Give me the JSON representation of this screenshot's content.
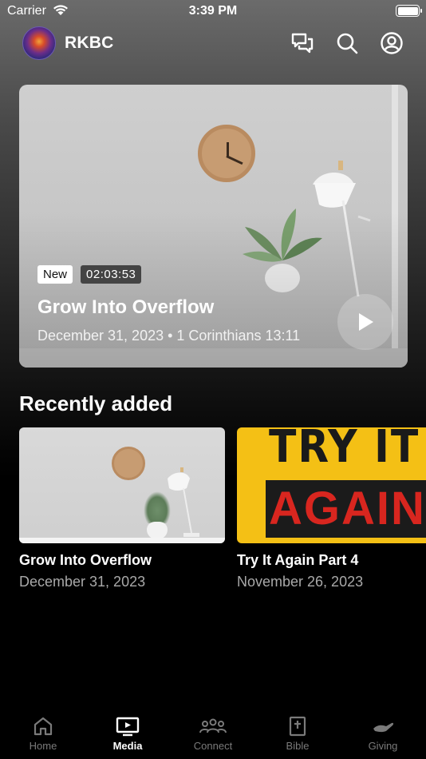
{
  "status_bar": {
    "carrier": "Carrier",
    "time": "3:39 PM"
  },
  "header": {
    "app_name": "RKBC",
    "icons": [
      "chat-icon",
      "search-icon",
      "profile-icon"
    ]
  },
  "featured": {
    "badge_new": "New",
    "duration": "02:03:53",
    "title": "Grow Into Overflow",
    "meta": "December 31, 2023 • 1 Corinthians 13:11"
  },
  "recent": {
    "heading": "Recently added",
    "items": [
      {
        "title": "Grow Into Overflow",
        "date": "December 31, 2023"
      },
      {
        "title": "Try It Again Part 4",
        "date": "November 26, 2023",
        "thumb_text_top": "TRY IT",
        "thumb_text_bottom": "AGAIN!"
      }
    ]
  },
  "tabs": [
    {
      "label": "Home",
      "icon": "home-icon"
    },
    {
      "label": "Media",
      "icon": "tv-icon",
      "active": true
    },
    {
      "label": "Connect",
      "icon": "people-icon"
    },
    {
      "label": "Bible",
      "icon": "bible-icon"
    },
    {
      "label": "Giving",
      "icon": "giving-hand-icon"
    }
  ],
  "colors": {
    "background": "#000000",
    "accent_thumb_yellow": "#f4c015",
    "accent_thumb_red": "#d8261f"
  }
}
